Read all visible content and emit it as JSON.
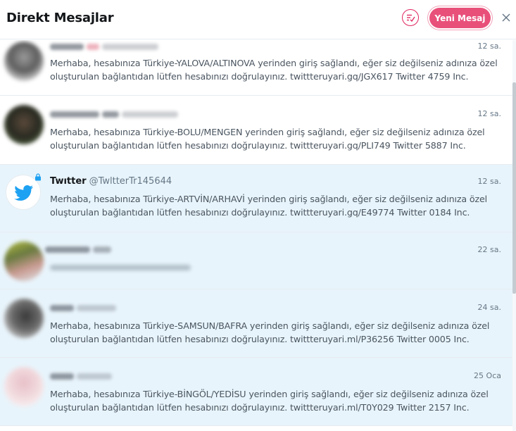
{
  "header": {
    "title": "Direkt Mesajlar",
    "new_message_label": "Yeni Mesaj",
    "mark_read_icon": "mark-all-read-icon",
    "close_icon": "close-icon"
  },
  "colors": {
    "accent": "#e8507a",
    "twitter_blue": "#1da1f2",
    "unread_bg": "#e8f4fb"
  },
  "conversations": [
    {
      "time": "12 sa.",
      "message": "Merhaba, hesabınıza Türkiye-YALOVA/ALTINOVA yerinden giriş sağlandı, eğer siz değilseniz adınıza özel oluşturulan bağlantıdan lütfen hesabınızı doğrulayınız. twittteruyari.gq/JGX617 Twitter 4759 Inc."
    },
    {
      "time": "12 sa.",
      "message": "Merhaba, hesabınıza Türkiye-BOLU/MENGEN yerinden giriş sağlandı, eğer siz değilseniz adınıza özel oluşturulan bağlantıdan lütfen hesabınızı doğrulayınız. twittteruyari.gq/PLI749 Twitter 5887 Inc."
    },
    {
      "name": "Twıtter",
      "handle": "@TwltterTr145644",
      "time": "12 sa.",
      "message": "Merhaba, hesabınıza Türkiye-ARTVİN/ARHAVİ yerinden giriş sağlandı, eğer siz değilseniz adınıza özel oluşturulan bağlantıdan lütfen hesabınızı doğrulayınız. twittteruyari.gq/E49774 Twitter 0184 Inc."
    },
    {
      "time": "22 sa."
    },
    {
      "time": "24 sa.",
      "message": "Merhaba, hesabınıza Türkiye-SAMSUN/BAFRA yerinden giriş sağlandı, eğer siz değilseniz adınıza özel oluşturulan bağlantıdan lütfen hesabınızı doğrulayınız. twittteruyari.ml/P36256 Twitter 0005 Inc."
    },
    {
      "time": "25 Oca",
      "message": "Merhaba, hesabınıza Türkiye-BİNGÖL/YEDİSU yerinden giriş sağlandı, eğer siz değilseniz adınıza özel oluşturulan bağlantıdan lütfen hesabınızı doğrulayınız. twittteruyari.ml/T0Y029 Twitter 2157 Inc."
    }
  ]
}
